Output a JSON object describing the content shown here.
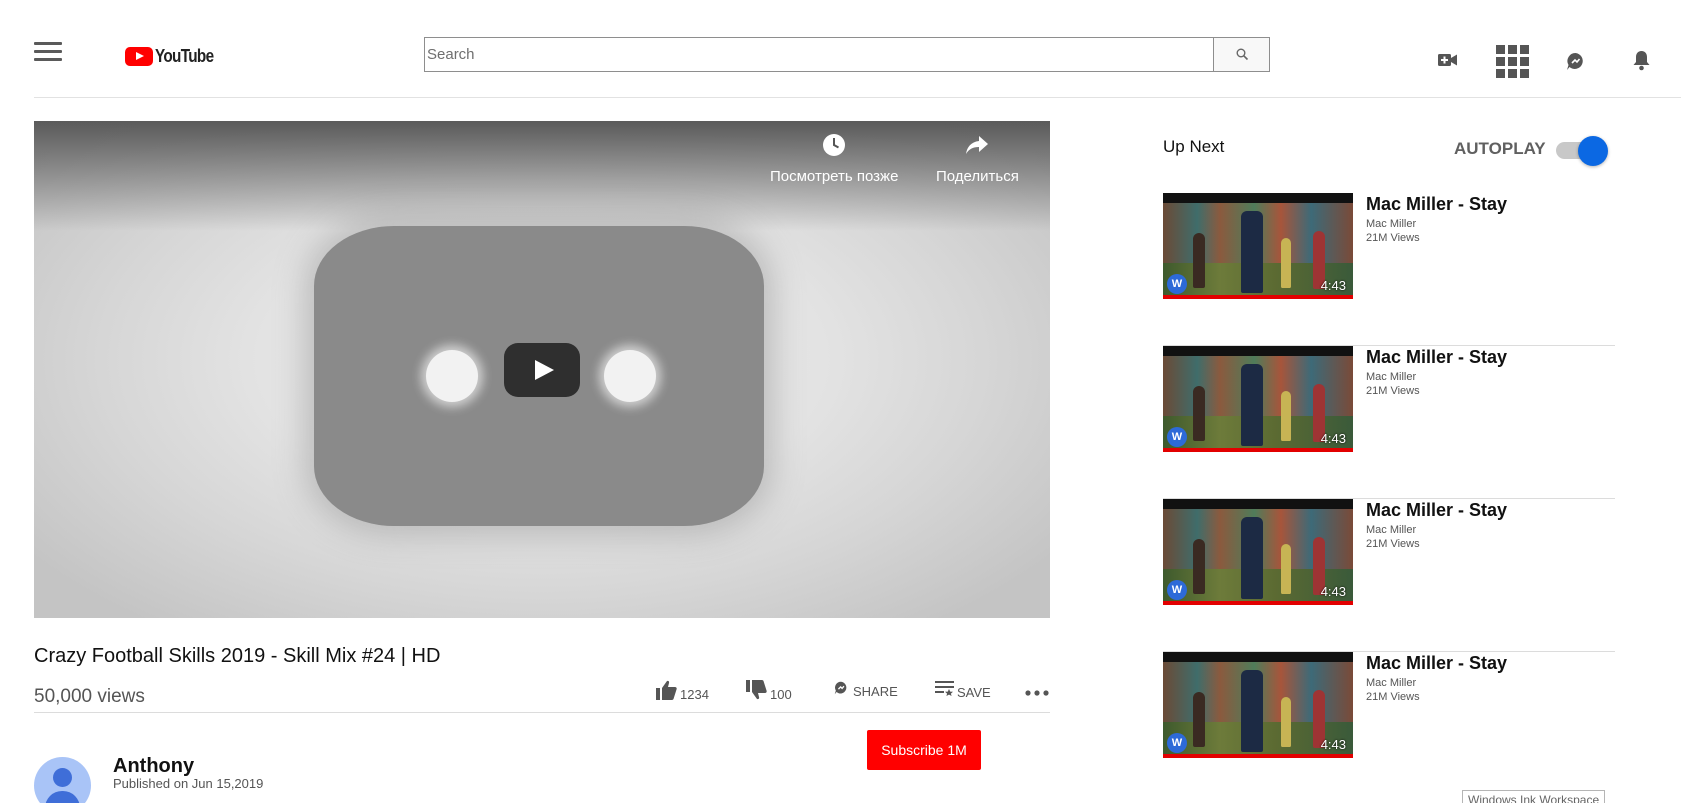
{
  "header": {
    "brand": "YouTube",
    "search_placeholder": "Search"
  },
  "player": {
    "watch_later": "Посмотреть позже",
    "share": "Поделиться"
  },
  "video": {
    "title": "Crazy Football Skills 2019 - Skill Mix #24 | HD",
    "views": "50,000 views",
    "likes": "1234",
    "dislikes": "100",
    "share_label": "SHARE",
    "save_label": "SAVE",
    "channel": "Anthony",
    "published": "Published on Jun 15,2019",
    "subscribe_label": "Subscribe 1M"
  },
  "sidebar": {
    "up_next": "Up Next",
    "autoplay": "AUTOPLAY",
    "items": [
      {
        "title": "Mac Miller - Stay",
        "channel": "Mac Miller",
        "views": "21M Views",
        "duration": "4:43"
      },
      {
        "title": "Mac Miller - Stay",
        "channel": "Mac Miller",
        "views": "21M Views",
        "duration": "4:43"
      },
      {
        "title": "Mac Miller - Stay",
        "channel": "Mac Miller",
        "views": "21M Views",
        "duration": "4:43"
      },
      {
        "title": "Mac Miller - Stay",
        "channel": "Mac Miller",
        "views": "21M Views",
        "duration": "4:43"
      }
    ]
  },
  "tooltip": "Windows Ink Workspace",
  "colors": {
    "brand_red": "#ff0000",
    "toggle_blue": "#0b68e3",
    "avatar_blue": "#3f6ed8"
  }
}
